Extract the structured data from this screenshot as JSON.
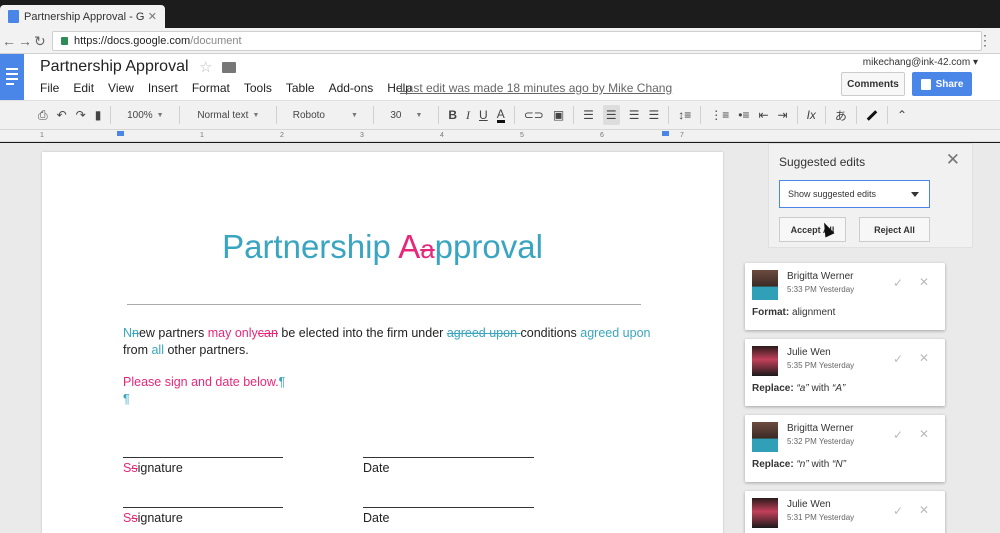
{
  "browser": {
    "tab_title": "Partnership Approval - Google",
    "url_host": "https://docs.google.com",
    "url_path": "/document"
  },
  "doc": {
    "title": "Partnership Approval",
    "menus": [
      "File",
      "Edit",
      "View",
      "Insert",
      "Format",
      "Tools",
      "Table",
      "Add-ons",
      "Help"
    ],
    "last_edit": "Last edit was made 18 minutes ago by Mike Chang",
    "user_email": "mikechang@ink-42.com",
    "comments_label": "Comments",
    "share_label": "Share"
  },
  "toolbar": {
    "zoom": "100%",
    "style": "Normal text",
    "font": "Roboto",
    "size": "30",
    "bold": "B",
    "italic": "I",
    "underline": "U",
    "text_color": "A",
    "clear_format": "Ix",
    "input_tools": "あ"
  },
  "ruler": [
    "1",
    "1",
    "2",
    "3",
    "4",
    "5",
    "6",
    "7"
  ],
  "body": {
    "heading_pre": "Partnership ",
    "heading_ins": "A",
    "heading_del": "a",
    "heading_post": "pproval",
    "p1": {
      "ins_N": "N",
      "del_n": "n",
      "t1": "ew partners ",
      "ins_may_only": "may only",
      "del_can": "can",
      "t2": " be elected into the firm under ",
      "del_agreed_upon": "agreed upon ",
      "t3": "conditions ",
      "ins_agreed_upon": "agreed upon",
      "t4": "from ",
      "ins_all": "all",
      "t5": " other partners."
    },
    "p2": "Please sign and date below.",
    "p2_pilcrow": "¶",
    "p3_pilcrow": "¶",
    "sig1_ins": "S",
    "sig1_del": "s",
    "sig1_rest": "ignature",
    "date1": "Date",
    "sig2_ins": "S",
    "sig2_del": "s",
    "sig2_rest": "ignature",
    "date2": "Date"
  },
  "suggested": {
    "title": "Suggested edits",
    "select_value": "Show suggested edits",
    "accept_all": "Accept All",
    "reject_all": "Reject All",
    "cards": [
      {
        "name": "Brigitta Werner",
        "time": "5:33 PM Yesterday",
        "label": "Format:",
        "desc": "alignment"
      },
      {
        "name": "Julie Wen",
        "time": "5:35 PM Yesterday",
        "label": "Replace:",
        "from": "“a”",
        "mid": " with ",
        "to": "“A”"
      },
      {
        "name": "Brigitta Werner",
        "time": "5:32 PM Yesterday",
        "label": "Replace:",
        "from": "“n”",
        "mid": " with ",
        "to": "“N”"
      },
      {
        "name": "Julie Wen",
        "time": "5:31 PM Yesterday"
      }
    ]
  },
  "colors": {
    "accent": "#4a86e8",
    "suggestion_teal": "#3aa5c0",
    "suggestion_pink": "#e6287b"
  }
}
